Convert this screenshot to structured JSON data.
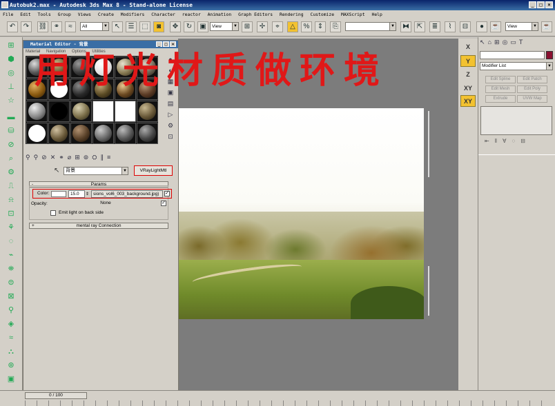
{
  "window": {
    "title": "Autobuk2.max - Autodesk 3ds Max 8 - Stand-alone License",
    "controls": [
      "_",
      "□",
      "×"
    ]
  },
  "menubar": [
    "File",
    "Edit",
    "Tools",
    "Group",
    "Views",
    "Create",
    "Modifiers",
    "Character",
    "reactor",
    "Animation",
    "Graph Editors",
    "Rendering",
    "Customize",
    "MAXScript",
    "Help"
  ],
  "toolbar": {
    "selection_filter": "All",
    "ref_coord": "View",
    "named_selection": "",
    "right_view": "View"
  },
  "overlay_caption": "用灯光材质做环境",
  "axis_constraints": [
    "X",
    "Y",
    "Z",
    "XY",
    "XY"
  ],
  "command_panel": {
    "modifier_list": "Modifier List",
    "buttons": [
      "Edit Spline",
      "Edit Patch",
      "Edit Mesh",
      "Edit Poly",
      "Extrude",
      "UVW Map"
    ]
  },
  "material_editor": {
    "title": "Material Editor - 背景",
    "menu": [
      "Material",
      "Navigation",
      "Options",
      "Utilities"
    ],
    "material_name": "背景",
    "material_type": "VRayLightMtl",
    "params_rollout": "Params",
    "color_label": "Color:",
    "multiplier": "15.0",
    "map_name": "sions_vol6_003_background.jpg)",
    "opacity_label": "Opacity:",
    "opacity_map": "None",
    "emit_back_label": "Emit light on back side",
    "mental_ray_rollout": "mental ray Connection",
    "rollout_minus": "-",
    "rollout_plus": "+"
  },
  "timeline": {
    "frame": "0 / 100"
  },
  "colors": {
    "accent_yellow": "#f3c230",
    "highlight_red": "#e01818",
    "title_blue": "#3a6ea5"
  }
}
